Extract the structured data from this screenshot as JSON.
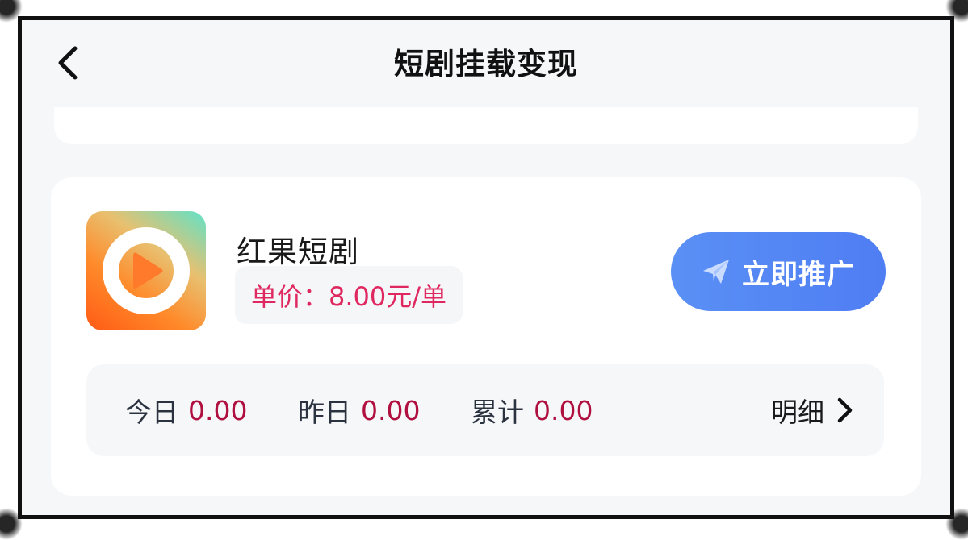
{
  "header": {
    "title": "短剧挂载变现",
    "back_icon": "chevron-left-icon"
  },
  "card": {
    "app_name": "红果短剧",
    "price_text": "单价：8.00元/单",
    "promote_label": "立即推广",
    "promote_icon": "paper-plane-icon",
    "stats": {
      "today_label": "今日",
      "today_value": "0.00",
      "yesterday_label": "昨日",
      "yesterday_value": "0.00",
      "total_label": "累计",
      "total_value": "0.00"
    },
    "detail_label": "明细",
    "detail_icon": "chevron-right-icon"
  },
  "colors": {
    "accent_blue": "#4f7df3",
    "price_red": "#e02860",
    "value_red": "#b01040",
    "background": "#f6f7f9"
  }
}
